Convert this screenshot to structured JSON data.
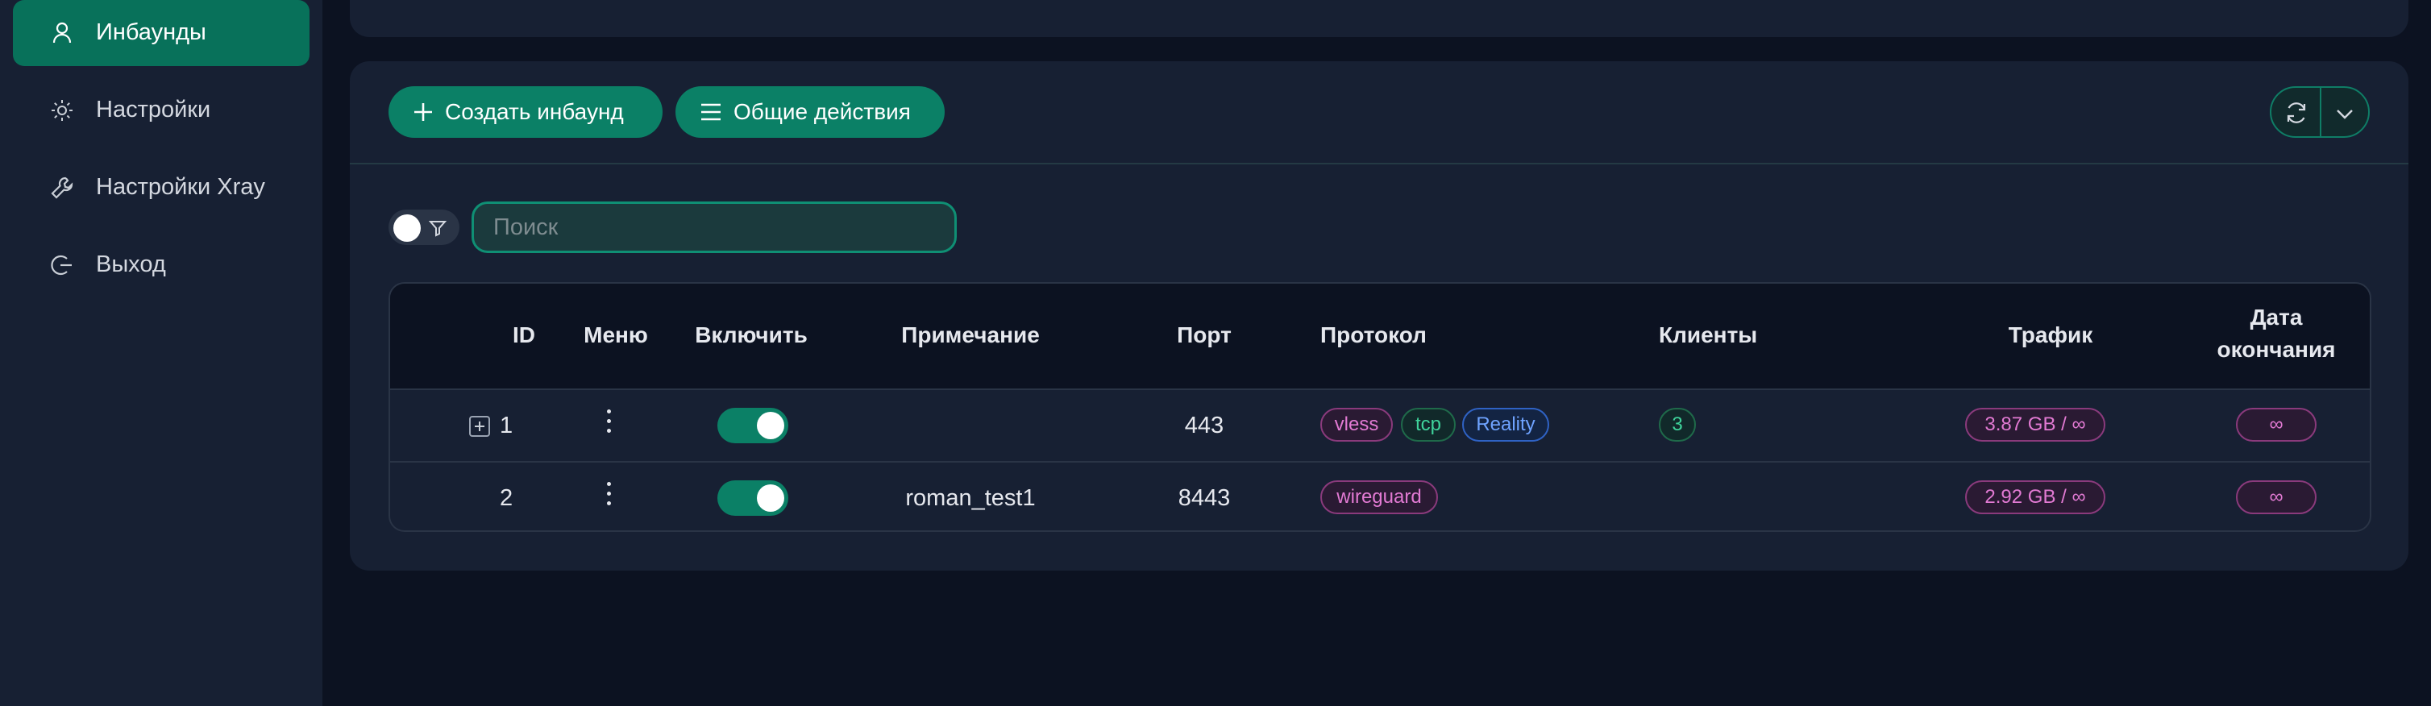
{
  "sidebar": {
    "items": [
      {
        "label": "Инбаунды",
        "icon": "user-icon",
        "active": true
      },
      {
        "label": "Настройки",
        "icon": "gear-icon",
        "active": false
      },
      {
        "label": "Настройки Xray",
        "icon": "wrench-icon",
        "active": false
      },
      {
        "label": "Выход",
        "icon": "logout-icon",
        "active": false
      }
    ]
  },
  "toolbar": {
    "create_label": "Создать инбаунд",
    "general_actions_label": "Общие действия"
  },
  "search": {
    "placeholder": "Поиск",
    "value": ""
  },
  "table": {
    "headers": {
      "id": "ID",
      "menu": "Меню",
      "enable": "Включить",
      "remark": "Примечание",
      "port": "Порт",
      "protocol": "Протокол",
      "clients": "Клиенты",
      "traffic": "Трафик",
      "expiry_line1": "Дата",
      "expiry_line2": "окончания"
    },
    "rows": [
      {
        "id": "1",
        "enabled": true,
        "remark": "",
        "port": "443",
        "tags": [
          "vless",
          "tcp",
          "Reality"
        ],
        "clients": "3",
        "traffic": "3.87 GB / ∞",
        "expiry": "∞"
      },
      {
        "id": "2",
        "enabled": true,
        "remark": "roman_test1",
        "port": "8443",
        "tags": [
          "wireguard"
        ],
        "clients": "",
        "traffic": "2.92 GB / ∞",
        "expiry": "∞"
      }
    ]
  },
  "colors": {
    "accent": "#0b8066",
    "background": "#0c1221",
    "panel": "#172033"
  }
}
